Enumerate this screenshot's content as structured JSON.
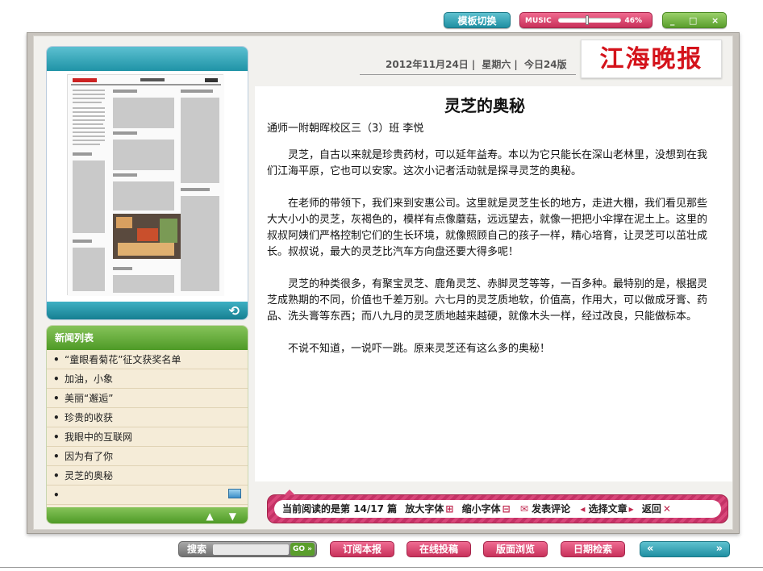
{
  "top": {
    "template_switch": "模板切换",
    "music_label": "MUSIC",
    "music_volume_pct": "46%",
    "music_volume_fraction": 0.46,
    "window_controls": [
      "_",
      "□",
      "×"
    ]
  },
  "header": {
    "date": "2012年11月24日",
    "weekday": "星期六",
    "edition": "今日24版",
    "logo": "江海晚报"
  },
  "news_list": {
    "title": "新闻列表",
    "items": [
      "“童眼看菊花”征文获奖名单",
      "加油，小象",
      "美丽“邂逅”",
      "珍贵的收获",
      "我眼中的互联网",
      "因为有了你",
      "灵芝的奥秘",
      ""
    ],
    "bullet": "•",
    "scroll_up": "▲",
    "scroll_down": "▼"
  },
  "article": {
    "title": "灵芝的奥秘",
    "author": "通师一附朝晖校区三（3）班 李悦",
    "paragraphs": [
      "灵芝，自古以来就是珍贵药材，可以延年益寿。本以为它只能长在深山老林里，没想到在我们江海平原，它也可以安家。这次小记者活动就是探寻灵芝的奥秘。",
      "在老师的带领下，我们来到安惠公司。这里就是灵芝生长的地方，走进大棚，我们看见那些大大小小的灵芝，灰褐色的，模样有点像蘑菇，远远望去，就像一把把小伞撑在泥土上。这里的叔叔阿姨们严格控制它们的生长环境，就像照顾自己的孩子一样，精心培育，让灵芝可以茁壮成长。叔叔说，最大的灵芝比汽车方向盘还要大得多呢！",
      "灵芝的种类很多，有聚宝灵芝、鹿角灵芝、赤脚灵芝等等，一百多种。最特别的是，根据灵芝成熟期的不同，价值也千差万别。六七月的灵芝质地软，价值高，作用大，可以做成牙膏、药品、洗头膏等东西；而八九月的灵芝质地越来越硬，就像木头一样，经过改良，只能做标本。",
      "不说不知道，一说吓一跳。原来灵芝还有这么多的奥秘！"
    ]
  },
  "status": {
    "reading_prefix": "当前阅读的是第",
    "reading_index": "14/17",
    "reading_suffix": "篇",
    "enlarge_font": "放大字体",
    "shrink_font": "缩小字体",
    "comment": "发表评论",
    "choose_article": "选择文章",
    "back": "返回"
  },
  "bottom": {
    "search_label": "搜索",
    "search_go": "GO »",
    "subscribe": "订阅本报",
    "submit": "在线投稿",
    "browse_layout": "版面浏览",
    "date_search": "日期检索",
    "prev": "«",
    "next": "»"
  },
  "colors": {
    "teal": "#1f8fa2",
    "pink": "#c8315a",
    "green": "#4e9a26",
    "logo_red": "#d4131b"
  }
}
